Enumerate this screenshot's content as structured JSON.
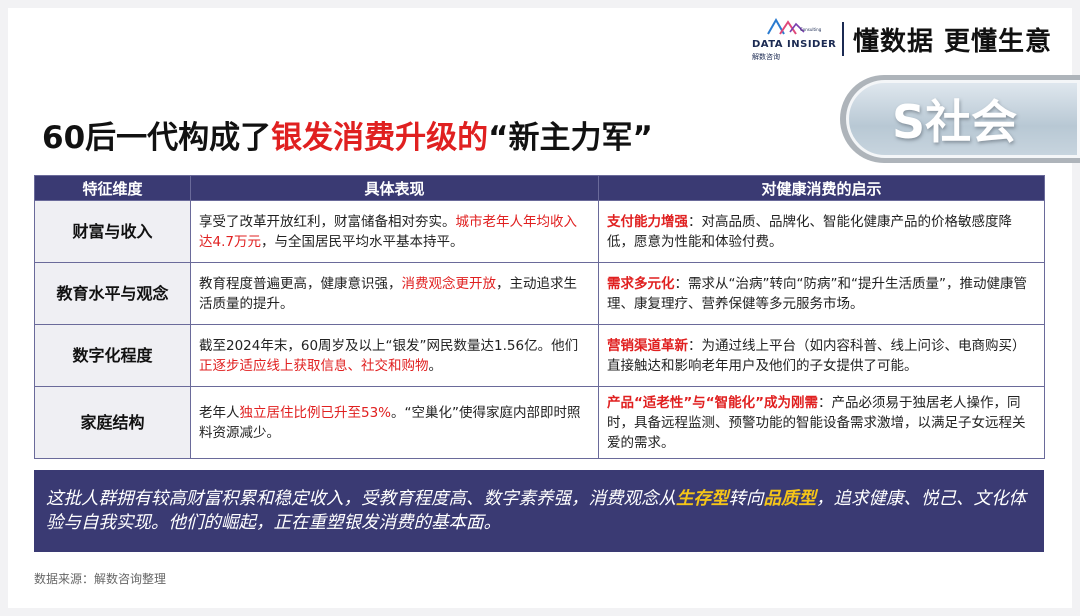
{
  "header": {
    "logo_text": "DATA INSIDER",
    "logo_sub": "解数咨询",
    "logo_tiny": "Consulting",
    "slogan": "懂数据 更懂生意"
  },
  "badge": {
    "text": "S社会"
  },
  "title": {
    "part1": "60后一代构成了",
    "part2": "银发消费升级的",
    "part3": "“新主力军”"
  },
  "table": {
    "headers": [
      "特征维度",
      "具体表现",
      "对健康消费的启示"
    ],
    "rows": [
      {
        "feature": "财富与收入",
        "detail_a": "享受了改革开放红利，财富储备相对夯实。",
        "detail_red": "城市老年人年均收入达4.7万元",
        "detail_b": "，与全国居民平均水平基本持平。",
        "insight_key": "支付能力增强",
        "insight_text": "：对高品质、品牌化、智能化健康产品的价格敏感度降低，愿意为性能和体验付费。"
      },
      {
        "feature": "教育水平与观念",
        "detail_a": "教育程度普遍更高，健康意识强，",
        "detail_red": "消费观念更开放",
        "detail_b": "，主动追求生活质量的提升。",
        "insight_key": "需求多元化",
        "insight_text": "：需求从“治病”转向“防病”和“提升生活质量”，推动健康管理、康复理疗、营养保健等多元服务市场。"
      },
      {
        "feature": "数字化程度",
        "detail_a": "截至2024年末，60周岁及以上“银发”网民数量达1.56亿。他们",
        "detail_red": "正逐步适应线上获取信息、社交和购物",
        "detail_b": "。",
        "insight_key": "营销渠道革新",
        "insight_text": "：为通过线上平台（如内容科普、线上问诊、电商购买）直接触达和影响老年用户及他们的子女提供了可能。"
      },
      {
        "feature": "家庭结构",
        "detail_a": "老年人",
        "detail_red": "独立居住比例已升至53%",
        "detail_b": "。“空巢化”使得家庭内部即时照料资源减少。",
        "insight_key": "产品“适老性”与“智能化”成为刚需",
        "insight_text": "：产品必须易于独居老人操作，同时，具备远程监测、预警功能的智能设备需求激增，以满足子女远程关爱的需求。"
      }
    ]
  },
  "summary": {
    "part1": "这批人群拥有较高财富积累和稳定收入，受教育程度高、数字素养强，消费观念从",
    "key1": "生存型",
    "part2": "转向",
    "key2": "品质型",
    "part3": "，追求健康、悦己、文化体验与自我实现。他们的崛起，正在重塑银发消费的基本面。"
  },
  "source": "数据来源：解数咨询整理",
  "colors": {
    "accent_red": "#e02020",
    "navy": "#3a3a73",
    "highlight_yellow": "#f5c518"
  }
}
